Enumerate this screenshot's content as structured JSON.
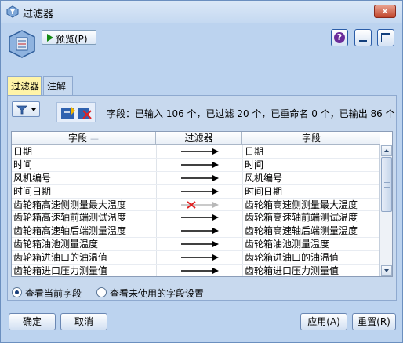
{
  "window": {
    "title": "过滤器",
    "close_label": "×"
  },
  "toolbar": {
    "preview_label": "预览(P)",
    "help_label": "?"
  },
  "tabs": [
    {
      "label": "过滤器",
      "active": true
    },
    {
      "label": "注解",
      "active": false
    }
  ],
  "summary": "字段：已输入 106 个，已过滤 20 个，已重命名 0 个，已输出 86 个",
  "table": {
    "headers": [
      "字段",
      "过滤器",
      "字段"
    ],
    "rows": [
      {
        "field": "日期",
        "filtered": false,
        "output": "日期"
      },
      {
        "field": "时间",
        "filtered": false,
        "output": "时间"
      },
      {
        "field": "风机编号",
        "filtered": false,
        "output": "风机编号"
      },
      {
        "field": "时间日期",
        "filtered": false,
        "output": "时间日期"
      },
      {
        "field": "齿轮箱高速侧测量最大温度",
        "filtered": true,
        "output": "齿轮箱高速侧测量最大温度"
      },
      {
        "field": "齿轮箱高速轴前端测试温度",
        "filtered": false,
        "output": "齿轮箱高速轴前端测试温度"
      },
      {
        "field": "齿轮箱高速轴后端测量温度",
        "filtered": false,
        "output": "齿轮箱高速轴后端测量温度"
      },
      {
        "field": "齿轮箱油池测量温度",
        "filtered": false,
        "output": "齿轮箱油池测量温度"
      },
      {
        "field": "齿轮箱进油口的油温值",
        "filtered": false,
        "output": "齿轮箱进油口的油温值"
      },
      {
        "field": "齿轮箱进口压力测量值",
        "filtered": false,
        "output": "齿轮箱进口压力测量值"
      }
    ]
  },
  "radios": [
    {
      "label": "查看当前字段",
      "selected": true
    },
    {
      "label": "查看未使用的字段设置",
      "selected": false
    }
  ],
  "buttons": {
    "ok": "确定",
    "cancel": "取消",
    "apply": "应用(A)",
    "reset": "重置(R)"
  },
  "colors": {
    "window_bg": "#bcd3ef",
    "active_tab": "#fff4a8",
    "filter_x": "#e02020"
  }
}
